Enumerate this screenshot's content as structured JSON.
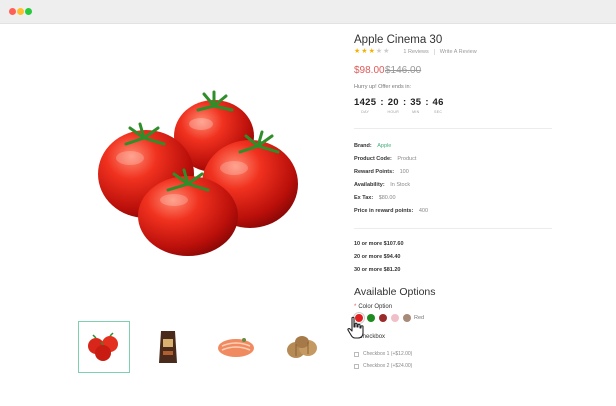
{
  "product": {
    "title": "Apple Cinema 30",
    "rating": 3,
    "rating_max": 5,
    "reviews_label": "1 Reviews",
    "write_review_label": "Write A Review",
    "price_new": "$98.00",
    "price_old": "$146.00"
  },
  "countdown": {
    "prompt": "Hurry up! Offer ends in:",
    "units": [
      {
        "value": "1425",
        "label": "DAY"
      },
      {
        "value": "20",
        "label": "HOUR"
      },
      {
        "value": "35",
        "label": "MIN"
      },
      {
        "value": "46",
        "label": "SEC"
      }
    ]
  },
  "specs": [
    {
      "key": "Brand:",
      "value": "Apple"
    },
    {
      "key": "Product Code:",
      "value": "Product"
    },
    {
      "key": "Reward Points:",
      "value": "100"
    },
    {
      "key": "Availability:",
      "value": "In Stock"
    },
    {
      "key": "Ex Tax:",
      "value": "$80.00"
    },
    {
      "key": "Price in reward points:",
      "value": "400"
    }
  ],
  "tiers": [
    "10 or more $107.60",
    "20 or more $94.40",
    "30 or more $81.20"
  ],
  "options": {
    "title": "Available Options",
    "color_label": "Color Option",
    "required_mark": "*",
    "colors": [
      {
        "name": "Red",
        "hex": "#e02020",
        "selected": true
      },
      {
        "name": "Green",
        "hex": "#1f8a1f",
        "selected": false
      },
      {
        "name": "Brown",
        "hex": "#9a2b2b",
        "selected": false
      },
      {
        "name": "Pink",
        "hex": "#f0c0c8",
        "selected": false
      },
      {
        "name": "Tan",
        "hex": "#a88a78",
        "selected": false
      }
    ],
    "selected_color_label": "Red",
    "checkbox_title": "Checkbox",
    "checkboxes": [
      "Checkbox 1 (+$12.00)",
      "Checkbox 2 (+$24.00)"
    ]
  },
  "thumbnails": [
    {
      "name": "tomatoes",
      "active": true
    },
    {
      "name": "coffee-bag",
      "active": false
    },
    {
      "name": "salmon-steak",
      "active": false
    },
    {
      "name": "walnuts",
      "active": false
    }
  ],
  "colors": {
    "accent_green": "#42b07a",
    "price_red": "#e05a5a",
    "star_yellow": "#f5b301"
  }
}
